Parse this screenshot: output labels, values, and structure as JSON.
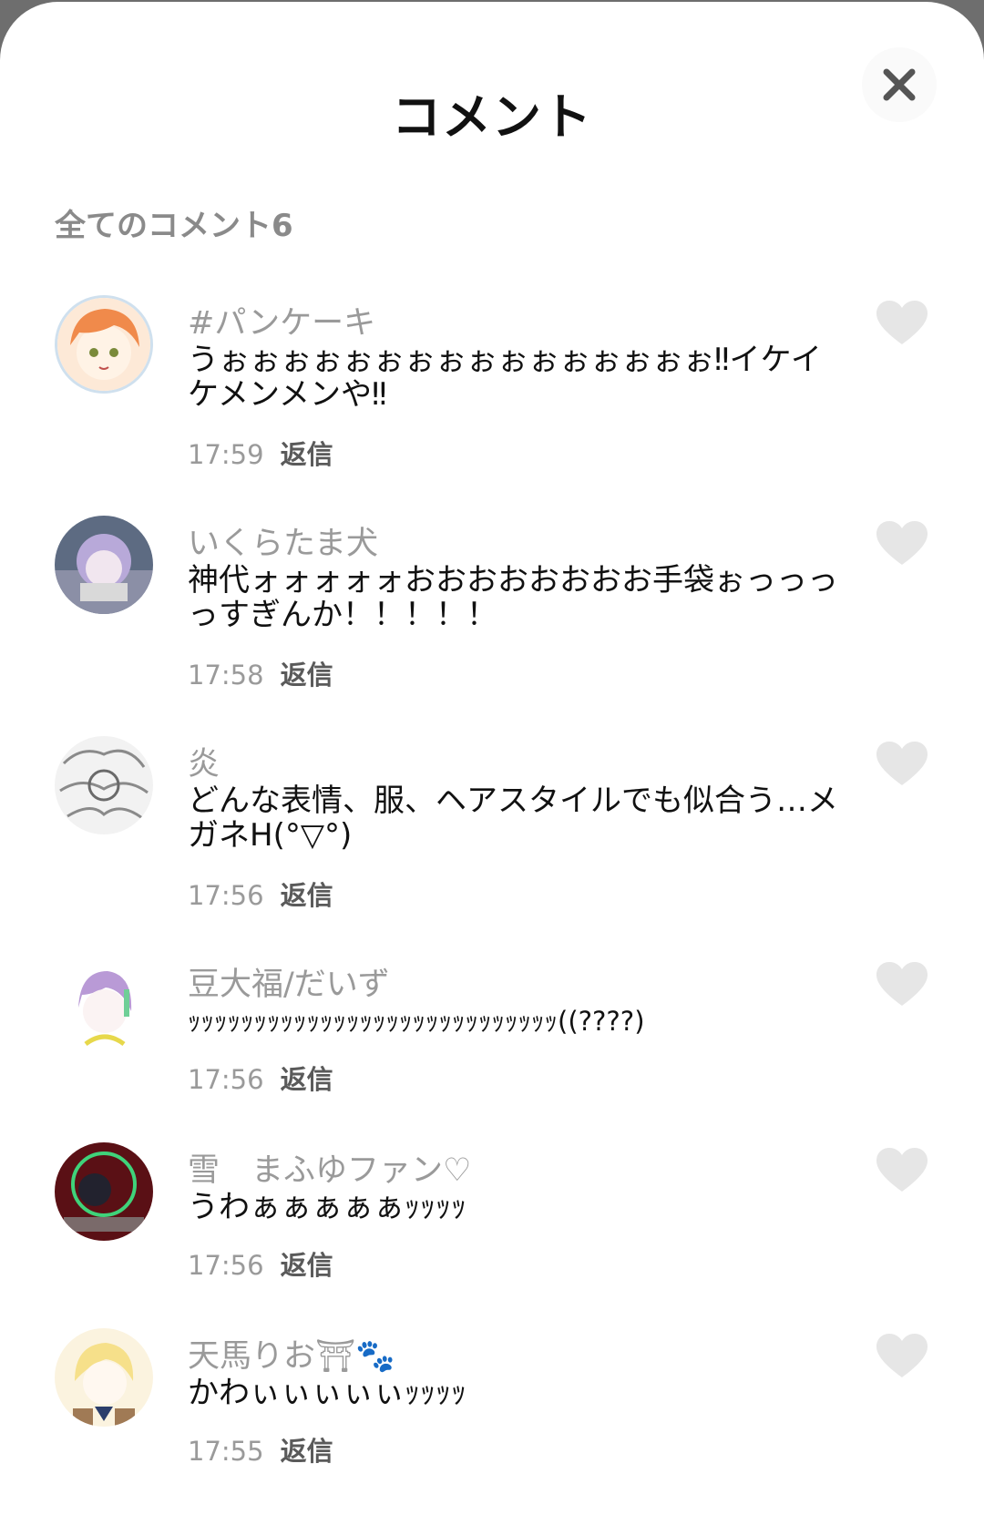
{
  "header": {
    "title": "コメント",
    "close_icon": "close-icon"
  },
  "section": {
    "title": "全てのコメント6"
  },
  "comments": [
    {
      "username": "#パンケーキ",
      "text": "うぉぉぉぉぉぉぉぉぉぉぉぉぉぉぉぉ‼イケイケメンメンや‼",
      "time": "17:59",
      "reply": "返信"
    },
    {
      "username": "いくらたま犬",
      "text": "神代ォォォォォおおおおおおおお手袋ぉっっっっすぎんか！！！！！",
      "time": "17:58",
      "reply": "返信"
    },
    {
      "username": "炎",
      "text": "どんな表情、服、ヘアスタイルでも似合う…メガネH(°▽°)",
      "time": "17:56",
      "reply": "返信"
    },
    {
      "username": "豆大福/だいず",
      "text": "ｯｯｯｯｯｯｯｯｯｯｯｯｯｯｯｯｯｯｯｯｯｯｯｯｯｯｯｯ((????)",
      "time": "17:56",
      "reply": "返信"
    },
    {
      "username": "雪　まふゆファン♡",
      "text": "うわぁぁぁぁぁｯｯｯｯ",
      "time": "17:56",
      "reply": "返信"
    },
    {
      "username": "天馬りお⛩🐾",
      "text": "かわぃぃぃぃぃｯｯｯｯ",
      "time": "17:55",
      "reply": "返信"
    }
  ],
  "colors": {
    "accent_avatar_1": "#f08a4b",
    "heart": "#e6e6e6",
    "muted_text": "#9a9a9a"
  }
}
